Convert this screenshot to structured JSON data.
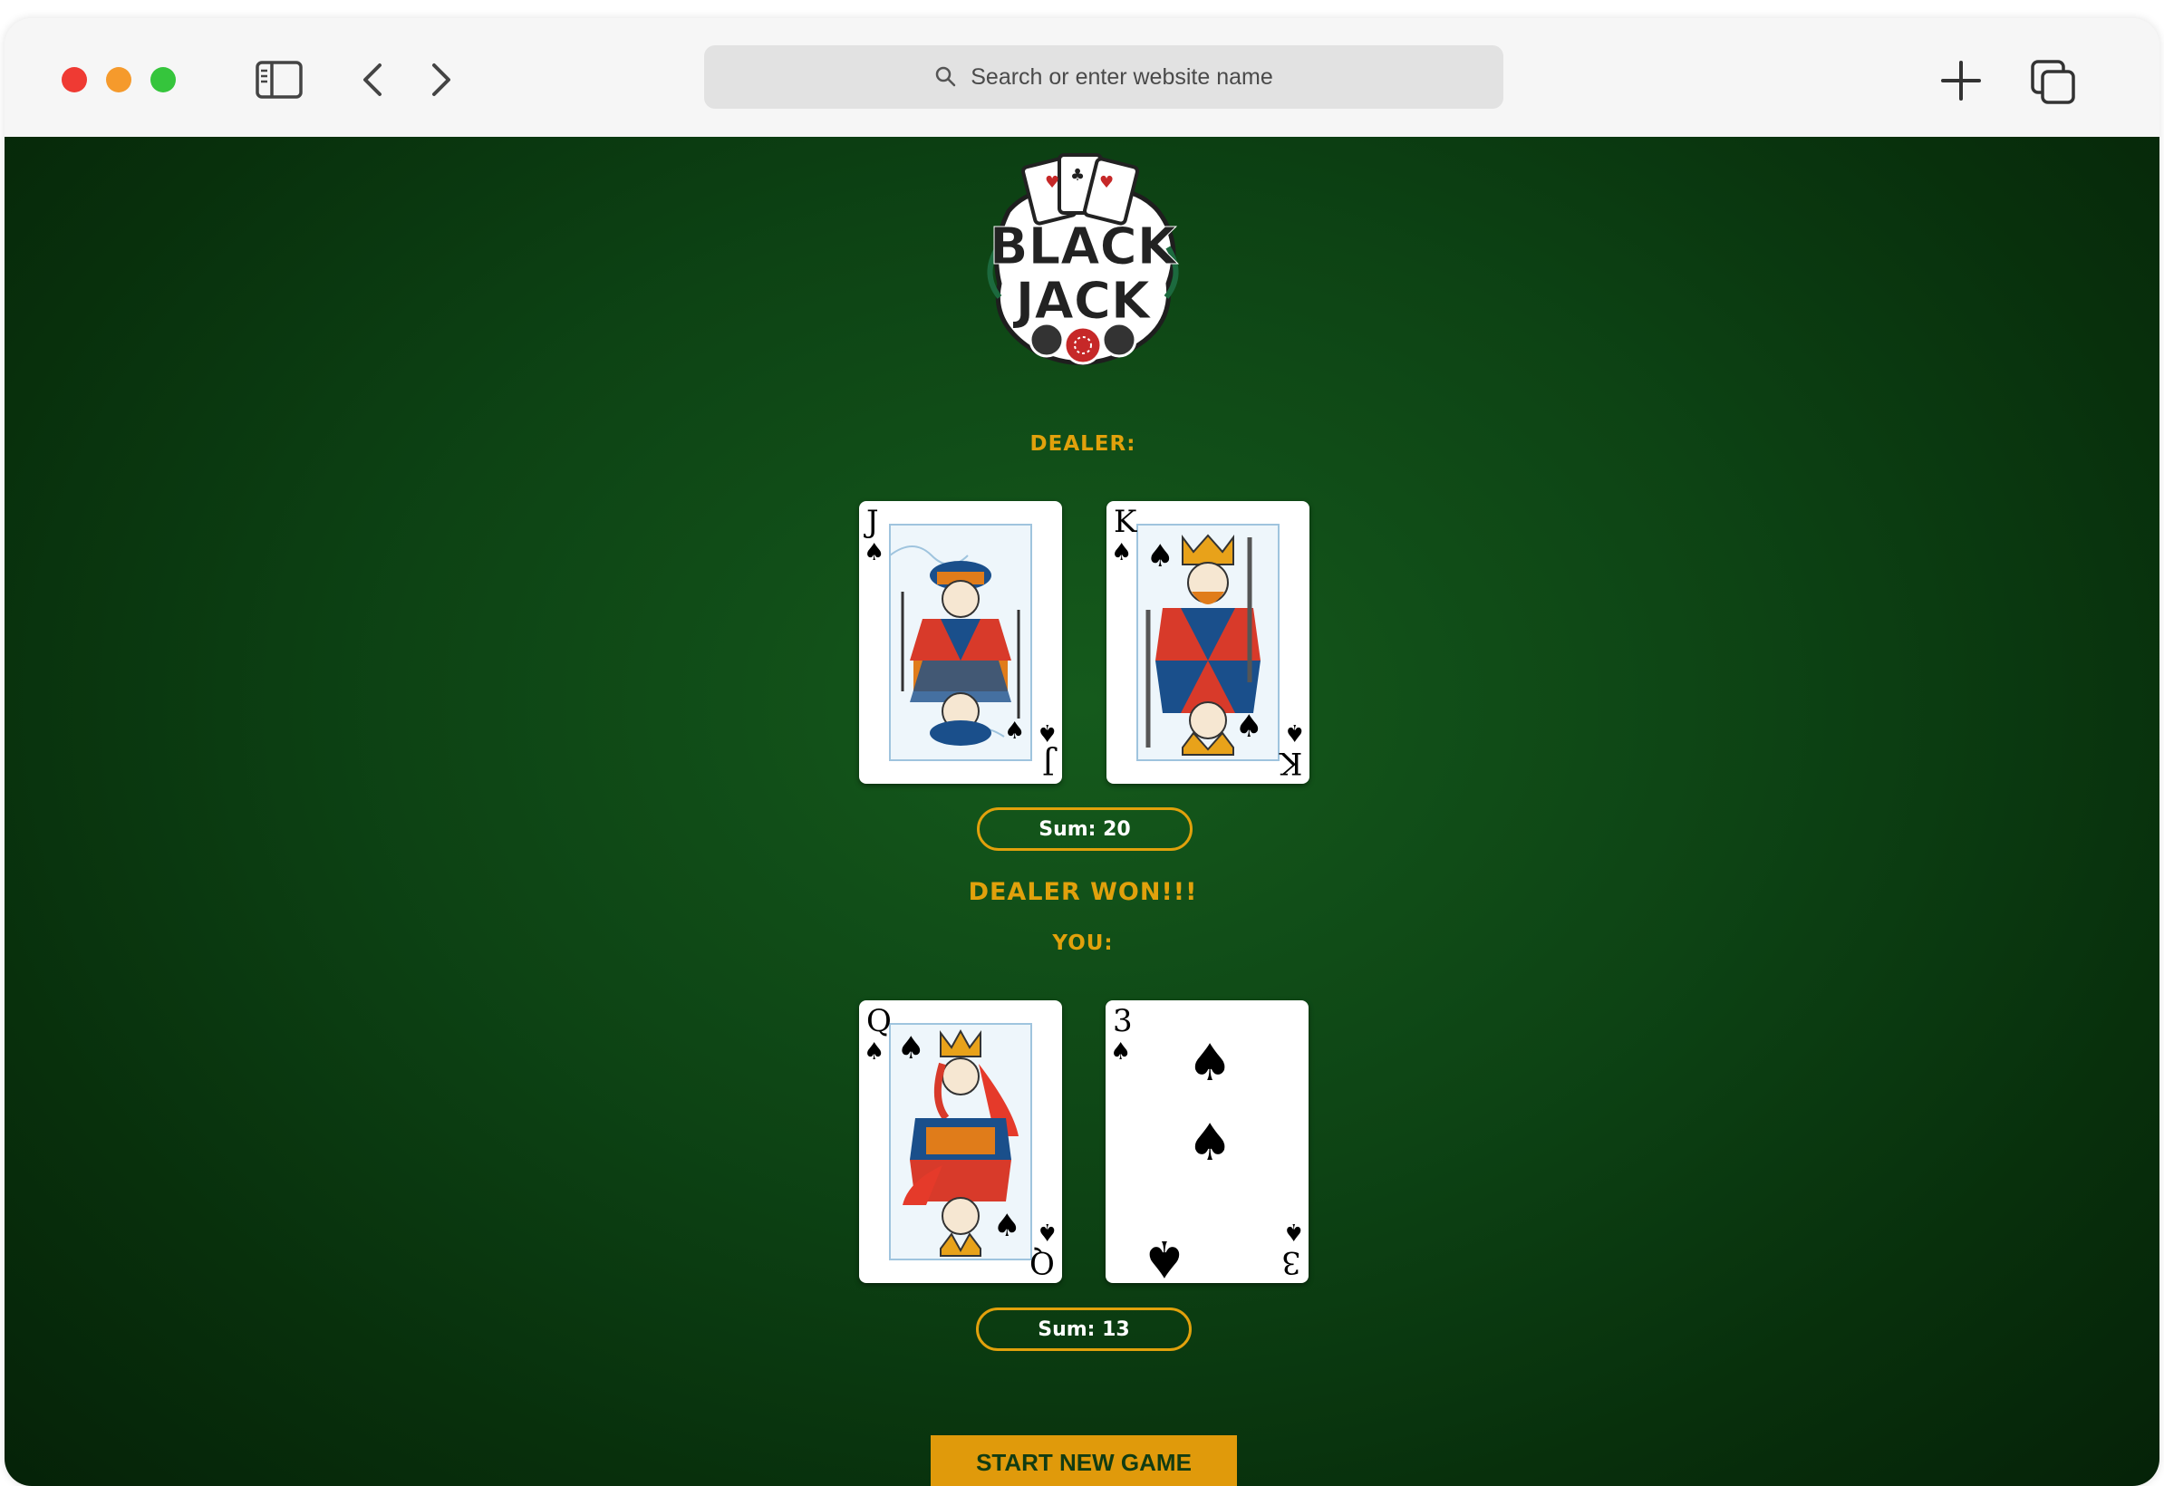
{
  "browser": {
    "address_placeholder": "Search or enter website name",
    "icons": [
      "sidebar-icon",
      "back-icon",
      "forward-icon",
      "search-icon",
      "new-tab-icon",
      "tabs-overview-icon"
    ]
  },
  "game": {
    "logo_text": "BLACK JACK",
    "dealer_label": "DEALER:",
    "player_label": "YOU:",
    "result_message": "DEALER WON!!!",
    "dealer_cards": [
      {
        "rank": "J",
        "suit": "♠",
        "name": "jack-of-spades"
      },
      {
        "rank": "K",
        "suit": "♠",
        "name": "king-of-spades"
      }
    ],
    "player_cards": [
      {
        "rank": "Q",
        "suit": "♠",
        "name": "queen-of-spades"
      },
      {
        "rank": "3",
        "suit": "♠",
        "name": "three-of-spades"
      }
    ],
    "dealer_sum": "Sum: 20",
    "player_sum": "Sum: 13",
    "start_button": "START NEW GAME"
  },
  "colors": {
    "felt": "#0d4314",
    "accent": "#e1a10c",
    "button_text": "#123c12"
  }
}
